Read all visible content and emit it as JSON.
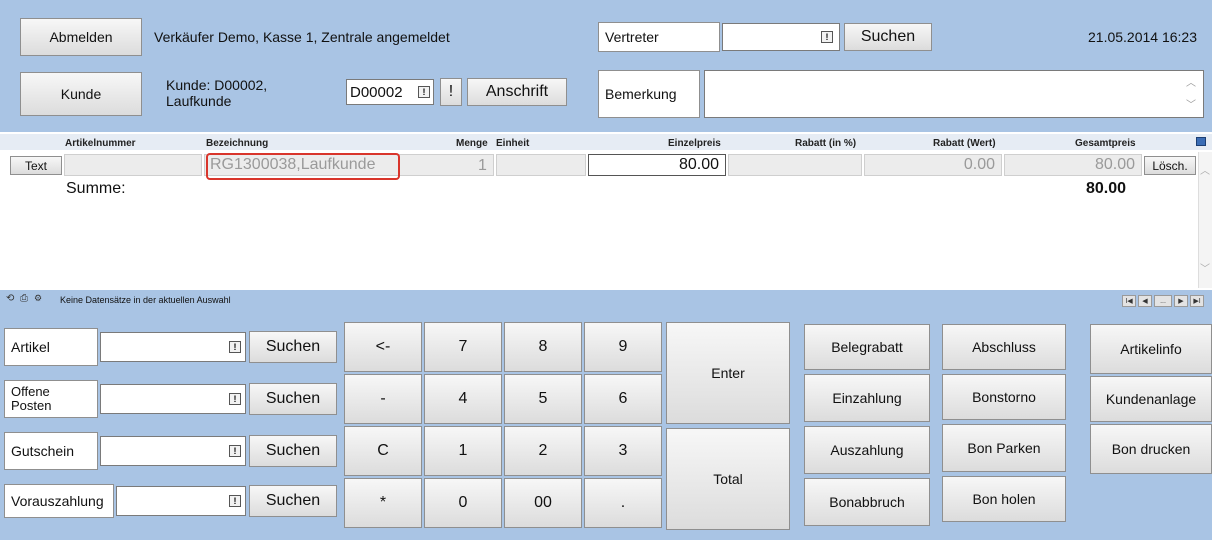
{
  "header": {
    "logout_button": "Abmelden",
    "session_text": "Verkäufer Demo, Kasse 1, Zentrale angemeldet",
    "rep_label": "Vertreter",
    "rep_search_button": "Suchen",
    "datetime": "21.05.2014 16:23",
    "customer_button": "Kunde",
    "customer_line1": "Kunde: D00002,",
    "customer_line2": "Laufkunde",
    "customer_code_value": "D00002",
    "exclaim_button": "!",
    "address_button": "Anschrift",
    "remark_label": "Bemerkung"
  },
  "grid": {
    "columns": [
      "Artikelnummer",
      "Bezeichnung",
      "Menge",
      "Einheit",
      "Einzelpreis",
      "Rabatt (in %)",
      "Rabatt (Wert)",
      "Gesamtpreis"
    ],
    "row": {
      "text_button": "Text",
      "designation": "RG1300038,Laufkunde",
      "quantity": "1",
      "unit_price": "80.00",
      "discount_value": "0.00",
      "total_price": "80.00",
      "delete_button": "Lösch."
    },
    "sum_label": "Summe:",
    "sum_value": "80.00"
  },
  "navbar": {
    "status_text": "Keine Datensätze in der aktuellen Auswahl",
    "nav_first": "I◀",
    "nav_prev": "◀",
    "nav_dots": "...",
    "nav_next": "▶",
    "nav_last": "▶I"
  },
  "search_rows": [
    {
      "label": "Artikel",
      "button": "Suchen"
    },
    {
      "label": "Offene\nPosten",
      "button": "Suchen"
    },
    {
      "label": "Gutschein",
      "button": "Suchen"
    },
    {
      "label": "Vorauszahlung",
      "button": "Suchen"
    }
  ],
  "keypad": {
    "back": "<-",
    "k7": "7",
    "k8": "8",
    "k9": "9",
    "minus": "-",
    "k4": "4",
    "k5": "5",
    "k6": "6",
    "clear": "C",
    "k1": "1",
    "k2": "2",
    "k3": "3",
    "star": "*",
    "k0": "0",
    "k00": "00",
    "dot": ".",
    "enter": "Enter",
    "total": "Total"
  },
  "actions": {
    "belegrabatt": "Belegrabatt",
    "einzahlung": "Einzahlung",
    "auszahlung": "Auszahlung",
    "bonabbruch": "Bonabbruch",
    "abschluss": "Abschluss",
    "bonstorno": "Bonstorno",
    "bon_parken": "Bon Parken",
    "bon_holen": "Bon holen",
    "artikelinfo": "Artikelinfo",
    "kundenanlage": "Kundenanlage",
    "bon_drucken": "Bon drucken"
  },
  "colors": {
    "panel_blue": "#a9c4e4",
    "highlight_red": "#d9352b"
  }
}
